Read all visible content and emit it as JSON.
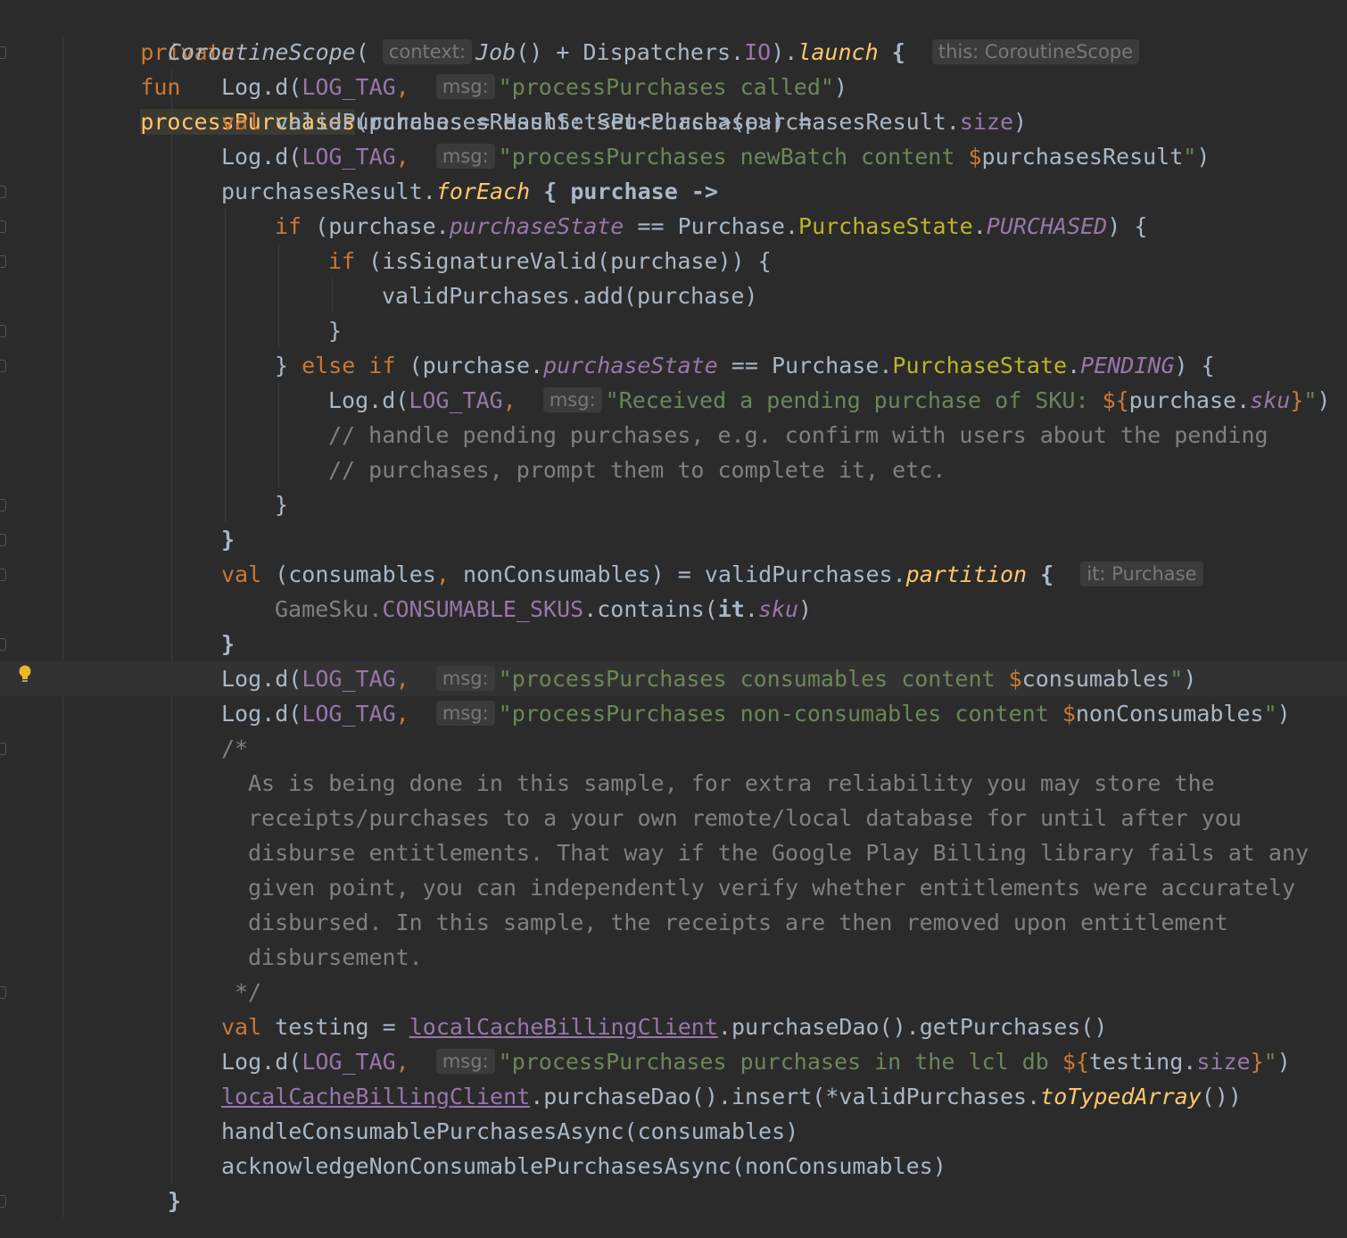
{
  "colors": {
    "background": "#2b2b2b",
    "keyword": "#cc7832",
    "function_declaration": "#ffc66d",
    "string": "#6a8759",
    "property": "#9876aa",
    "comment": "#808080",
    "default_text": "#a9b7c6",
    "enum_class": "#bbb529",
    "hint": "#787878"
  },
  "icons": {
    "intention_bulb": "lightbulb-icon"
  },
  "code": {
    "l1": {
      "private": "private",
      "fun": "fun",
      "name": "processPurchases",
      "rest": "(purchasesResult: Set<Purchase>) ="
    },
    "l2": {
      "scope": "CoroutineScope",
      "open": "(",
      "hint_context": "context:",
      "job": "Job",
      "mid": "() + Dispatchers.",
      "io": "IO",
      "close": ").",
      "launch": "launch",
      "brace": " {",
      "hint_this": "this: CoroutineScope"
    },
    "l3": {
      "log": "Log.d(",
      "tag": "LOG_TAG",
      "comma": ", ",
      "hint_msg": "msg:",
      "str": "\"processPurchases called\"",
      "end": ")"
    },
    "l4": {
      "val": "val",
      "a": " validPurchases = HashSet<Purchase>(purchasesResult.",
      "size": "size",
      "end": ")"
    },
    "l5": {
      "log": "Log.d(",
      "tag": "LOG_TAG",
      "comma": ", ",
      "hint_msg": "msg:",
      "str": "\"processPurchases newBatch content ",
      "dollar": "$",
      "var": "purchasesResult",
      "q": "\"",
      "end": ")"
    },
    "l6": {
      "a": "purchasesResult.",
      "foreach": "forEach",
      "b": " { purchase ->"
    },
    "l7": {
      "if": "if",
      "a": " (purchase.",
      "state": "purchaseState",
      "b": " == Purchase.",
      "ps": "PurchaseState",
      "dot": ".",
      "purchased": "PURCHASED",
      "c": ") {"
    },
    "l8": {
      "if": "if",
      "a": " (isSignatureValid(purchase)) {"
    },
    "l9": {
      "a": "validPurchases.add(purchase)"
    },
    "l10": {
      "a": "}"
    },
    "l11": {
      "a": "} ",
      "else": "else",
      "sp": " ",
      "if": "if",
      "b": " (purchase.",
      "state": "purchaseState",
      "c": " == Purchase.",
      "ps": "PurchaseState",
      "dot": ".",
      "pending": "PENDING",
      "d": ") {"
    },
    "l12": {
      "log": "Log.d(",
      "tag": "LOG_TAG",
      "comma": ", ",
      "hint_msg": "msg:",
      "str": "\"Received a pending purchase of SKU: ",
      "open": "${",
      "var": "purchase.",
      "sku": "sku",
      "close": "}",
      "q": "\"",
      "end": ")"
    },
    "l13": {
      "cmt": "// handle pending purchases, e.g. confirm with users about the pending"
    },
    "l14": {
      "cmt": "// purchases, prompt them to complete it, etc."
    },
    "l15": {
      "a": "}"
    },
    "l16": {
      "a": "}"
    },
    "l17": {
      "val": "val",
      "a": " (consumables",
      "comma": ",",
      "b": " nonConsumables) = validPurchases.",
      "partition": "partition",
      "c": " {",
      "hint_it": "it: Purchase"
    },
    "l18": {
      "a": "GameSku.",
      "skus": "CONSUMABLE_SKUS",
      "b": ".contains(",
      "it": "it",
      "dot": ".",
      "sku": "sku",
      "c": ")"
    },
    "l19": {
      "a": "}"
    },
    "l20": {
      "log": "Log.d(",
      "tag": "LOG_TAG",
      "comma": ", ",
      "hint_msg": "msg:",
      "str": "\"processPurchases consumables content ",
      "dollar": "$",
      "var": "consumables",
      "q": "\"",
      "end": ")"
    },
    "l21": {
      "log": "Log.d(",
      "tag": "LOG_TAG",
      "comma": ", ",
      "hint_msg": "msg:",
      "str": "\"processPurchases non-consumables content ",
      "dollar": "$",
      "var": "nonConsumables",
      "q": "\"",
      "end": ")"
    },
    "l22": {
      "cmt": "/*"
    },
    "l23": {
      "cmt": "As is being done in this sample, for extra reliability you may store the"
    },
    "l24": {
      "cmt": "receipts/purchases to a your own remote/local database for until after you"
    },
    "l25": {
      "cmt": "disburse entitlements. That way if the Google Play Billing library fails at any"
    },
    "l26": {
      "cmt": "given point, you can independently verify whether entitlements were accurately"
    },
    "l27": {
      "cmt": "disbursed. In this sample, the receipts are then removed upon entitlement"
    },
    "l28": {
      "cmt": "disbursement."
    },
    "l29": {
      "cmt": "*/"
    },
    "l30": {
      "val": "val",
      "a": " testing = ",
      "client": "localCacheBillingClient",
      "b": ".purchaseDao().getPurchases()"
    },
    "l31": {
      "log": "Log.d(",
      "tag": "LOG_TAG",
      "comma": ", ",
      "hint_msg": "msg:",
      "str": "\"processPurchases purchases in the lcl db ",
      "open": "${",
      "var": "testing.",
      "size": "size",
      "close": "}",
      "q": "\"",
      "end": ")"
    },
    "l32": {
      "client": "localCacheBillingClient",
      "a": ".purchaseDao().insert(*validPurchases.",
      "typed": "toTypedArray",
      "b": "())"
    },
    "l33": {
      "a": "handleConsumablePurchasesAsync(consumables)"
    },
    "l34": {
      "a": "acknowledgeNonConsumablePurchasesAsync(nonConsumables)"
    },
    "l35": {
      "a": "}"
    }
  }
}
